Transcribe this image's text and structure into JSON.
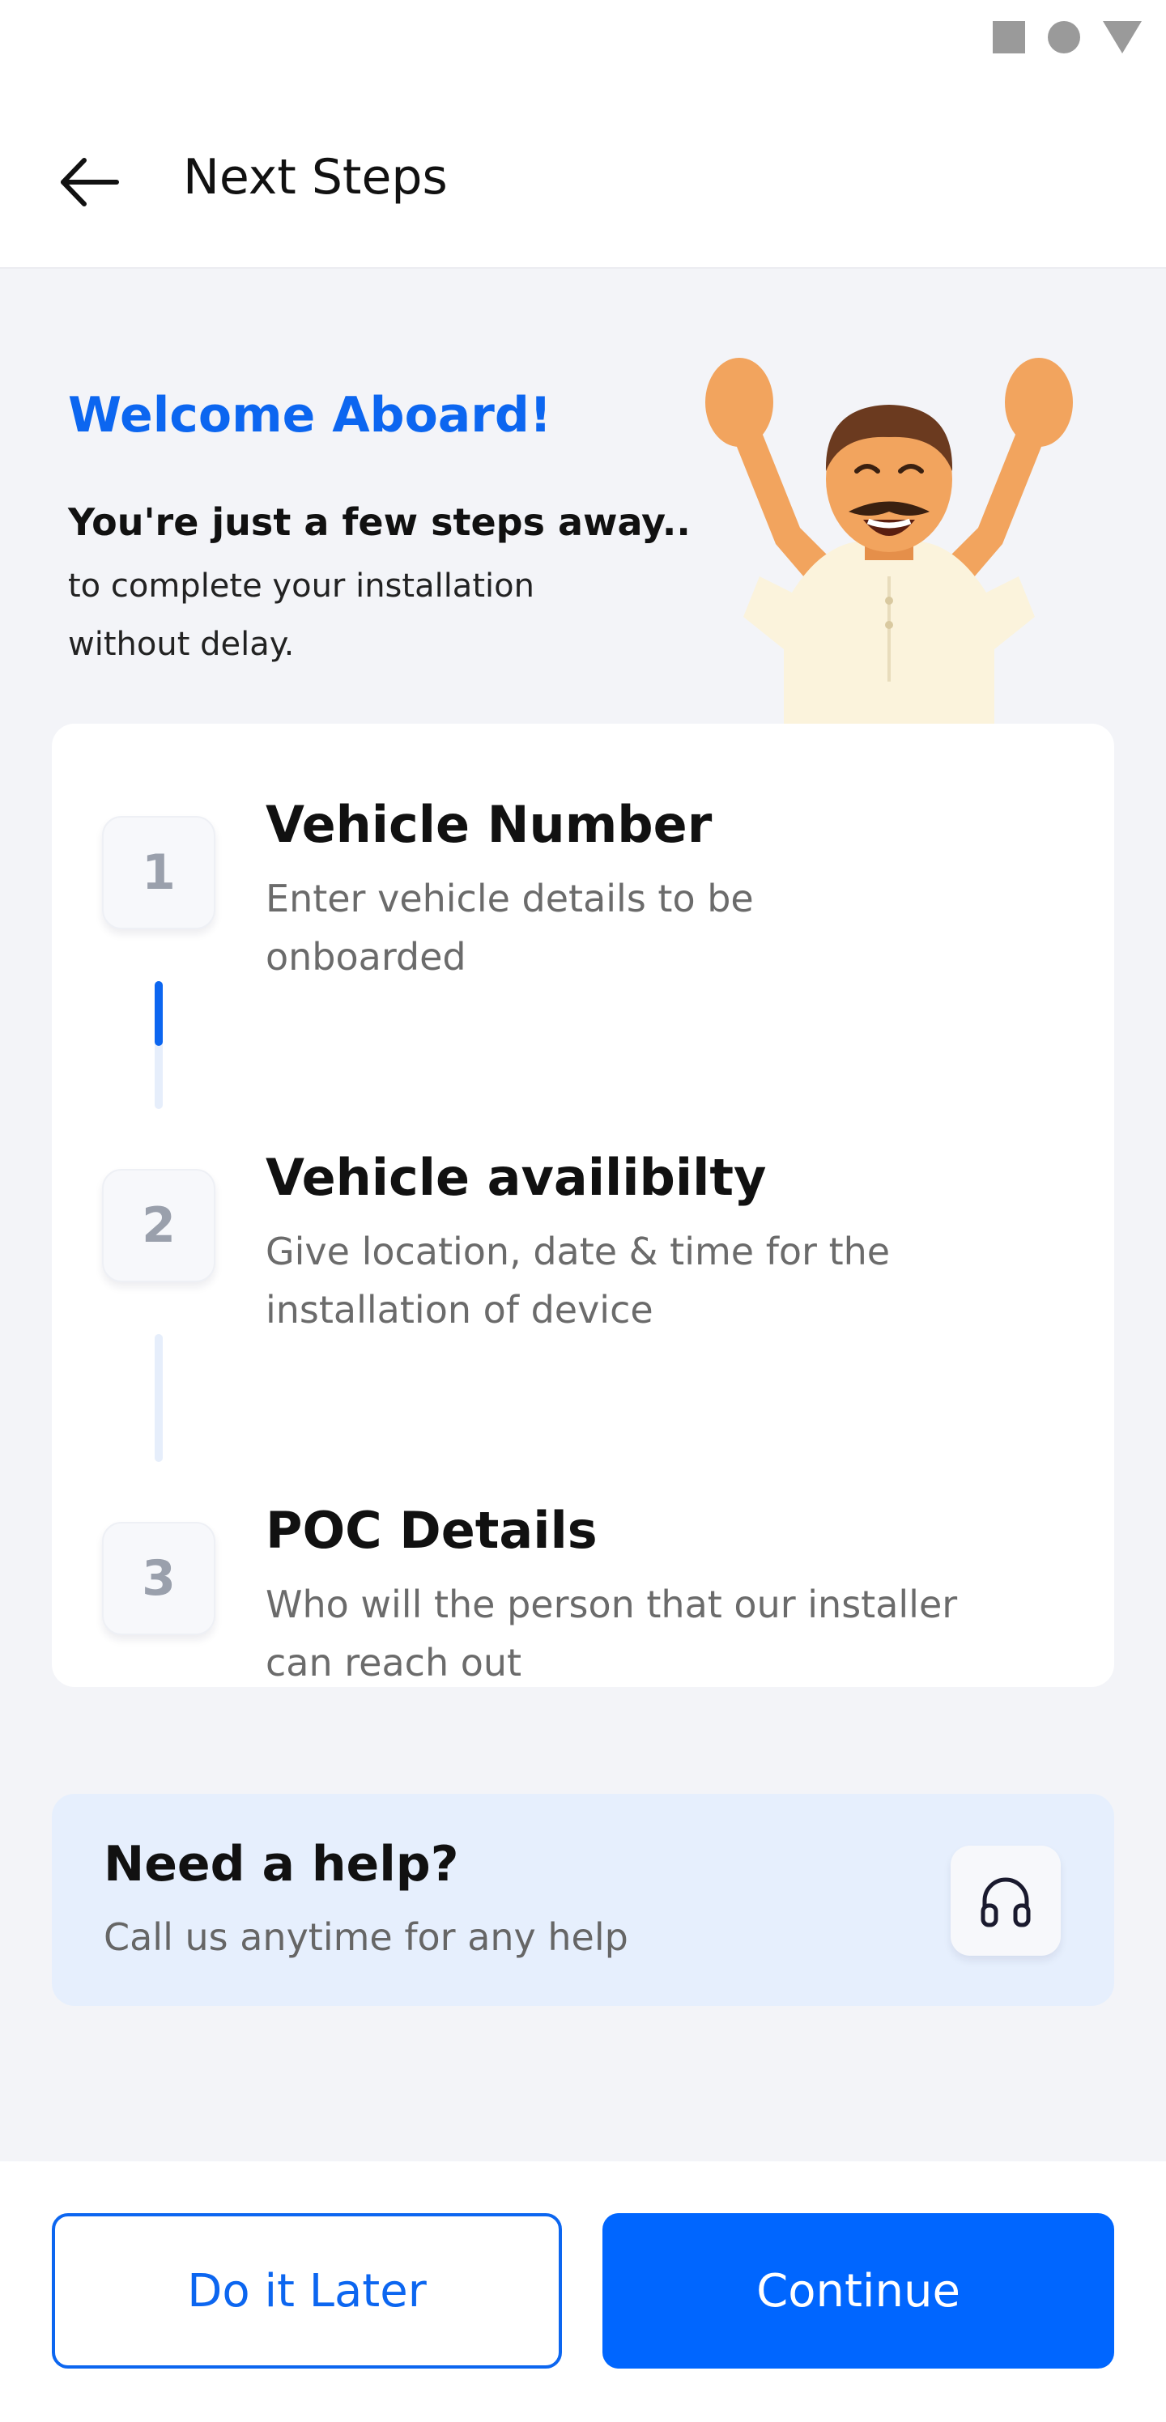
{
  "status_bar": {
    "icons": [
      "square-icon",
      "circle-icon",
      "triangle-icon"
    ]
  },
  "header": {
    "title": "Next Steps",
    "back_icon": "arrow-left-icon"
  },
  "welcome": {
    "title": "Welcome Aboard!",
    "subtitle": "You're just a few steps away..",
    "description": "to complete your installation without delay."
  },
  "steps": [
    {
      "number": "1",
      "title": "Vehicle Number",
      "description": "Enter vehicle details to be onboarded",
      "active": true
    },
    {
      "number": "2",
      "title": "Vehicle availibilty",
      "description": "Give location, date & time for the installation of device",
      "active": false
    },
    {
      "number": "3",
      "title": "POC Details",
      "description": "Who will the person that our installer can reach out",
      "active": false
    }
  ],
  "help": {
    "title": "Need a help?",
    "description": "Call us anytime for any help",
    "icon": "headphones-icon"
  },
  "footer": {
    "later_label": "Do it Later",
    "continue_label": "Continue"
  },
  "colors": {
    "primary": "#0066ff",
    "background": "#f3f4f8",
    "help_background": "#e6effd",
    "muted_text": "#6b6b6b"
  }
}
